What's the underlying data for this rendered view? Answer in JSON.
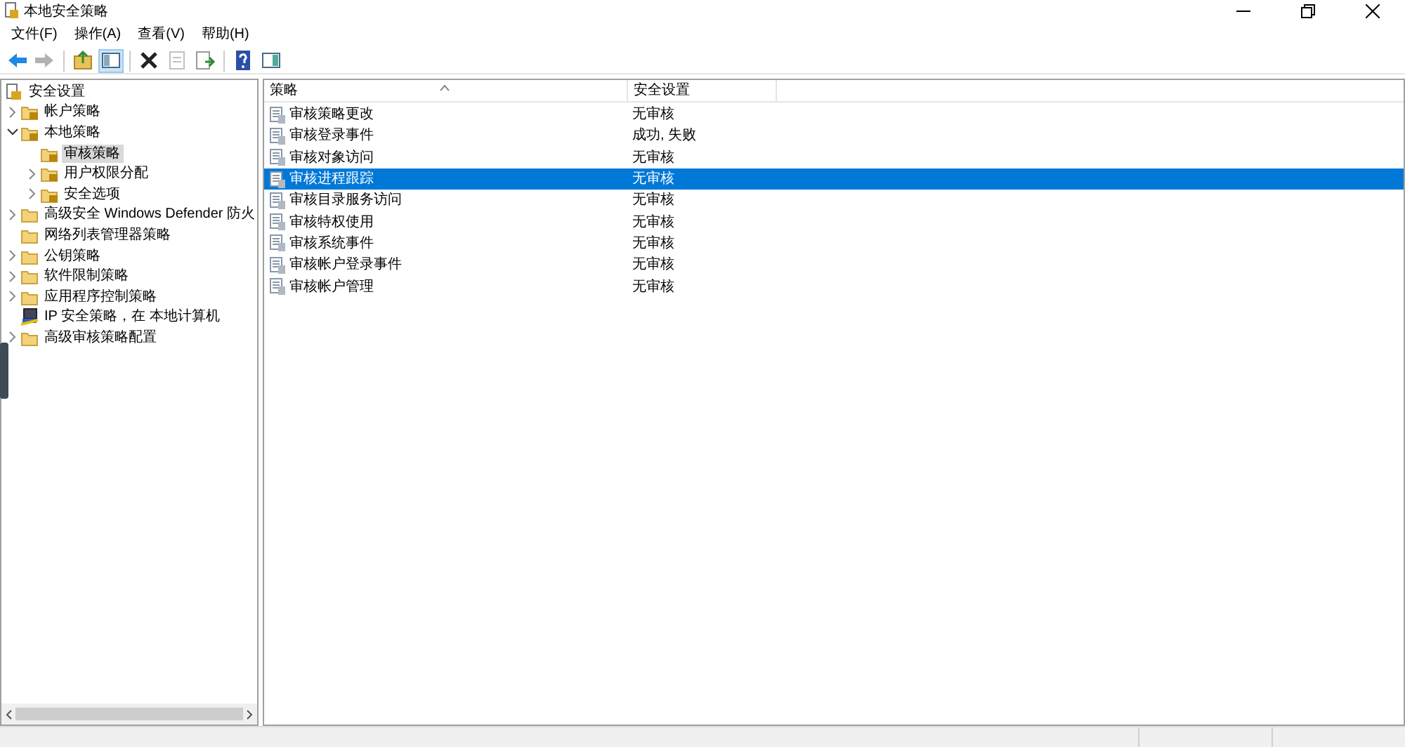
{
  "window": {
    "title": "本地安全策略"
  },
  "menu": [
    "文件(F)",
    "操作(A)",
    "查看(V)",
    "帮助(H)"
  ],
  "toolbar": [
    {
      "kind": "back",
      "disabled": false
    },
    {
      "kind": "forward",
      "disabled": true
    },
    {
      "kind": "sep"
    },
    {
      "kind": "up",
      "disabled": false
    },
    {
      "kind": "tree",
      "disabled": false,
      "selected": true
    },
    {
      "kind": "sep"
    },
    {
      "kind": "delete",
      "disabled": false
    },
    {
      "kind": "properties",
      "disabled": true
    },
    {
      "kind": "export",
      "disabled": false
    },
    {
      "kind": "sep"
    },
    {
      "kind": "help",
      "disabled": false
    },
    {
      "kind": "pane",
      "disabled": false,
      "selected": false
    }
  ],
  "tree": [
    {
      "label": "安全设置",
      "kind": "root",
      "selected": false,
      "children": [
        {
          "label": "帐户策略",
          "kind": "policy",
          "expanded": false,
          "selected": false
        },
        {
          "label": "本地策略",
          "kind": "policy",
          "expanded": true,
          "selected": false,
          "children": [
            {
              "label": "审核策略",
              "kind": "policy",
              "selected": true
            },
            {
              "label": "用户权限分配",
              "kind": "policy",
              "expanded": false,
              "selected": false
            },
            {
              "label": "安全选项",
              "kind": "policy",
              "expanded": false,
              "selected": false
            }
          ]
        },
        {
          "label": "高级安全 Windows Defender 防火",
          "kind": "folder",
          "expanded": false,
          "selected": false
        },
        {
          "label": "网络列表管理器策略",
          "kind": "folder",
          "selected": false
        },
        {
          "label": "公钥策略",
          "kind": "folder",
          "expanded": false,
          "selected": false
        },
        {
          "label": "软件限制策略",
          "kind": "folder",
          "expanded": false,
          "selected": false
        },
        {
          "label": "应用程序控制策略",
          "kind": "folder",
          "expanded": false,
          "selected": false
        },
        {
          "label": "IP 安全策略，在 本地计算机",
          "kind": "network",
          "selected": false
        },
        {
          "label": "高级审核策略配置",
          "kind": "folder",
          "expanded": false,
          "selected": false
        }
      ]
    }
  ],
  "table": {
    "columns": [
      "策略",
      "安全设置"
    ],
    "rows": [
      {
        "policy": "审核策略更改",
        "setting": "无审核",
        "selected": false
      },
      {
        "policy": "审核登录事件",
        "setting": "成功, 失败",
        "selected": false
      },
      {
        "policy": "审核对象访问",
        "setting": "无审核",
        "selected": false
      },
      {
        "policy": "审核进程跟踪",
        "setting": "无审核",
        "selected": true
      },
      {
        "policy": "审核目录服务访问",
        "setting": "无审核",
        "selected": false
      },
      {
        "policy": "审核特权使用",
        "setting": "无审核",
        "selected": false
      },
      {
        "policy": "审核系统事件",
        "setting": "无审核",
        "selected": false
      },
      {
        "policy": "审核帐户登录事件",
        "setting": "无审核",
        "selected": false
      },
      {
        "policy": "审核帐户管理",
        "setting": "无审核",
        "selected": false
      }
    ]
  }
}
